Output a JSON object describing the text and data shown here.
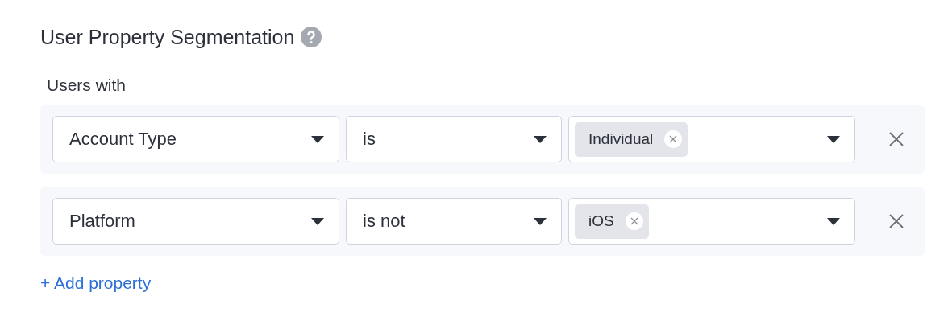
{
  "title": "User Property Segmentation",
  "subtitle": "Users with",
  "filters": [
    {
      "property": "Account Type",
      "operator": "is",
      "values": [
        "Individual"
      ]
    },
    {
      "property": "Platform",
      "operator": "is not",
      "values": [
        "iOS"
      ]
    }
  ],
  "add_link": "+ Add property"
}
